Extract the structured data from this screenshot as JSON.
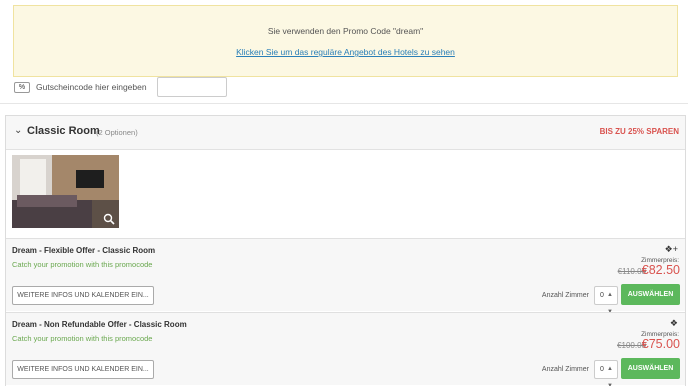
{
  "promo": {
    "message": "Sie verwenden den Promo Code \"dream\"",
    "link": "Klicken Sie um das reguläre Angebot des Hotels zu sehen"
  },
  "voucher": {
    "badge": "%",
    "label": "Gutscheincode hier eingeben",
    "value": ""
  },
  "room": {
    "title": "Classic Room",
    "options": "(2 Optionen)",
    "save_badge": "BIS ZU 25% SPAREN",
    "offers": [
      {
        "title": "Dream - Flexible Offer - Classic Room",
        "promo": "Catch your promotion with this promocode",
        "more_button": "WEITERE INFOS UND KALENDER EIN...",
        "guest_icon": "guests-2-plus-icon",
        "price_label": "Zimmerpreis:",
        "price_old": "€110.00",
        "price_new": "€82.50",
        "qty_label": "Anzahl Zimmer",
        "qty_value": "0",
        "select_button": "AUSWÄHLEN"
      },
      {
        "title": "Dream - Non Refundable Offer - Classic Room",
        "promo": "Catch your promotion with this promocode",
        "more_button": "WEITERE INFOS UND KALENDER EIN...",
        "guest_icon": "guests-2-icon",
        "price_label": "Zimmerpreis:",
        "price_old": "€100.00",
        "price_new": "€75.00",
        "qty_label": "Anzahl Zimmer",
        "qty_value": "0",
        "select_button": "AUSWÄHLEN"
      }
    ]
  },
  "colors": {
    "banner_bg": "#fcf8e3",
    "link": "#2a7fb8",
    "save": "#d9534f",
    "promo_text": "#6aa84f",
    "select_button": "#5cb85c"
  }
}
